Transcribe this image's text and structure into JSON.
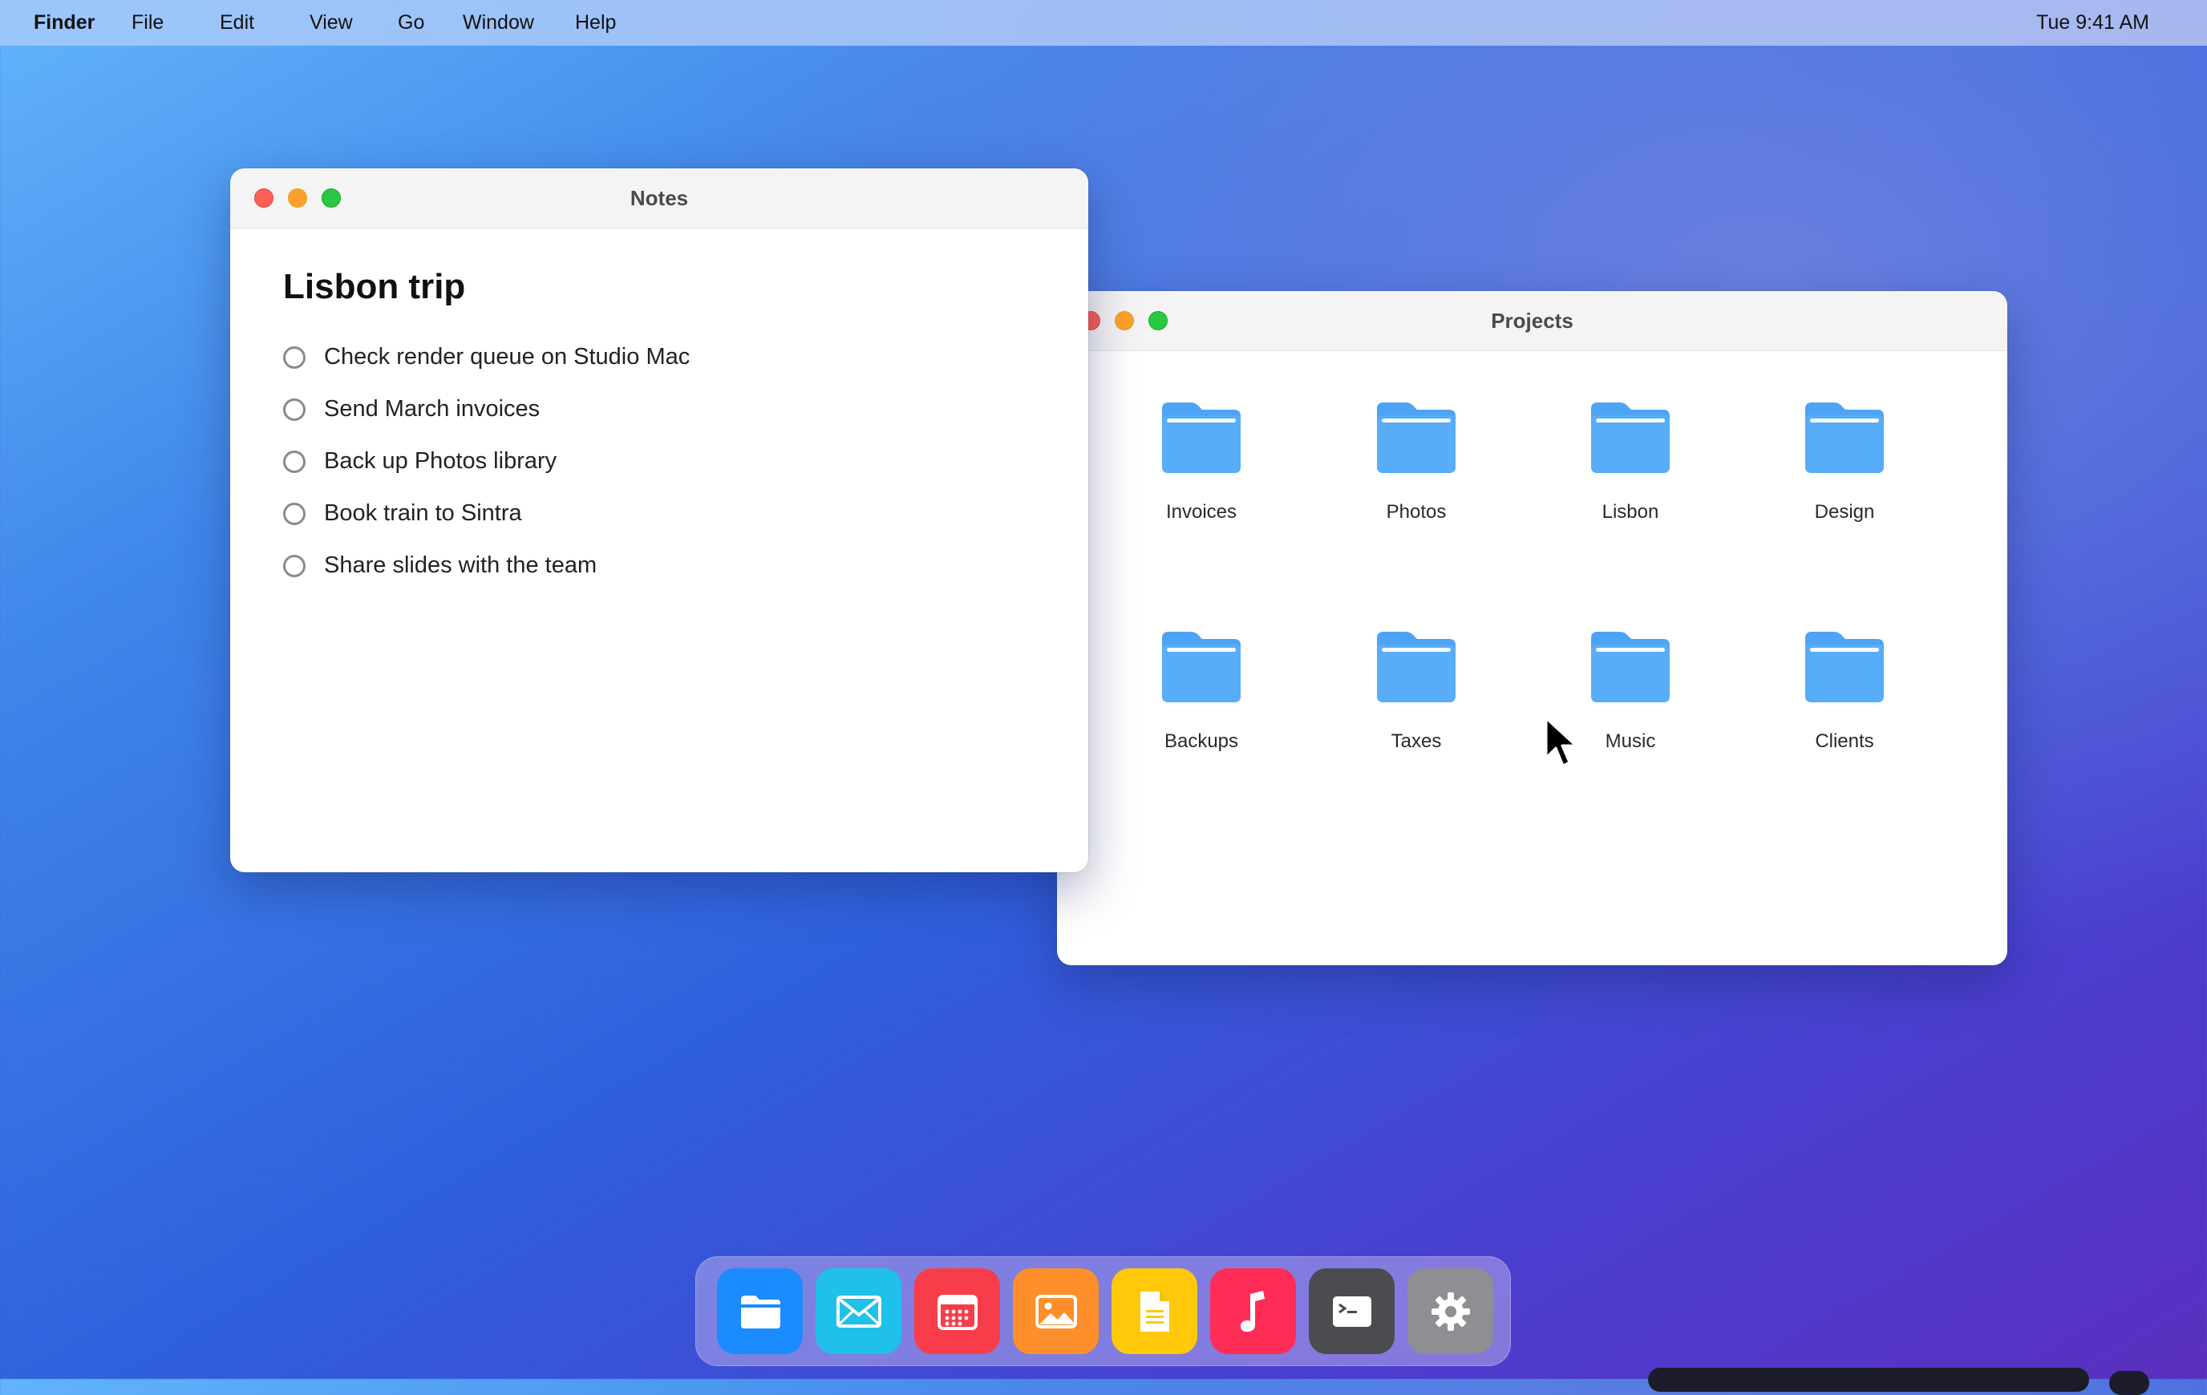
{
  "menubar": {
    "app": "Finder",
    "items": [
      "File",
      "Edit",
      "View",
      "Go",
      "Window",
      "Help"
    ],
    "clock": "Tue 9:41 AM"
  },
  "finder": {
    "title": "Projects",
    "folders": [
      "Invoices",
      "Photos",
      "Lisbon",
      "Design",
      "Backups",
      "Taxes",
      "Music",
      "Clients"
    ],
    "folder_color": "#4da3f5"
  },
  "notes": {
    "window_title": "Notes",
    "heading": "Lisbon trip",
    "todos": [
      "Check render queue on Studio Mac",
      "Send March invoices",
      "Back up Photos library",
      "Book train to Sintra",
      "Share slides with the team"
    ]
  },
  "dock": {
    "apps": [
      {
        "icon": "finder-icon",
        "color": "#1a8cff"
      },
      {
        "icon": "mail-icon",
        "color": "#1fc0ea"
      },
      {
        "icon": "calendar-icon",
        "color": "#f83d4a"
      },
      {
        "icon": "photos-icon",
        "color": "#ff8f2a"
      },
      {
        "icon": "notes-icon",
        "color": "#ffc90a"
      },
      {
        "icon": "music-icon",
        "color": "#ff2d55"
      },
      {
        "icon": "terminal-icon",
        "color": "#4b4b50"
      },
      {
        "icon": "settings-icon",
        "color": "#8e8e93"
      }
    ]
  }
}
